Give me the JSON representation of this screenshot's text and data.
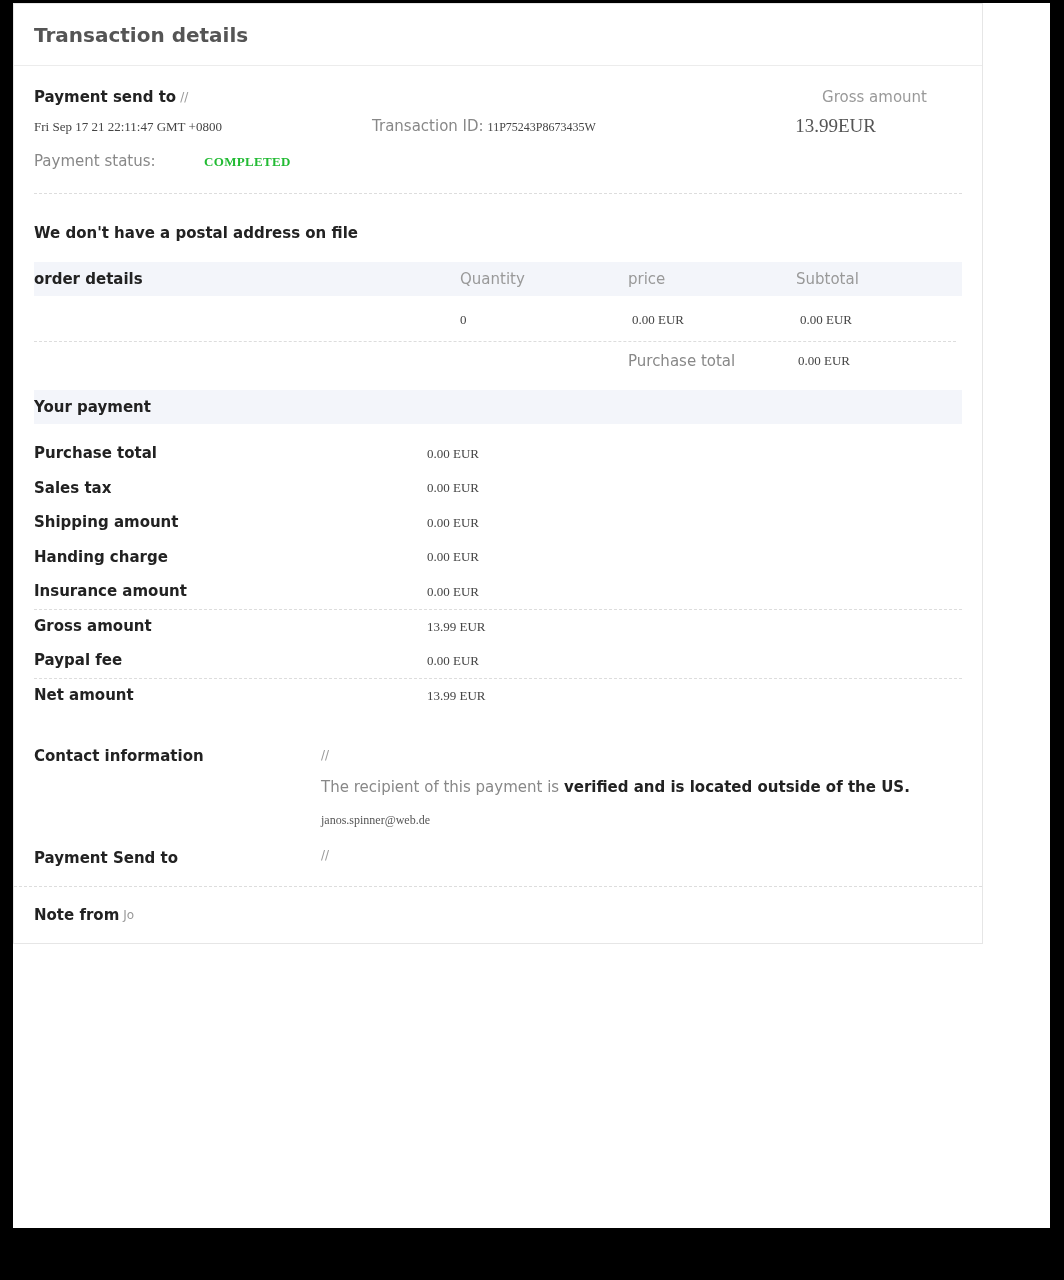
{
  "title": "Transaction details",
  "header": {
    "recipient_label": "Payment send to",
    "recipient_value": "//",
    "date": "Fri Sep 17 21 22:11:47 GMT +0800",
    "transaction_id_label": "Transaction ID:",
    "transaction_id": "11P75243P8673435W",
    "gross_label": "Gross amount",
    "gross_value": "13.99EUR",
    "status_label": "Payment status:",
    "status": "COMPLETED"
  },
  "address_note": "We don't have a postal address on file",
  "order": {
    "columns": [
      "order details",
      "Quantity",
      "price",
      "Subtotal"
    ],
    "rows": [
      {
        "cells": [
          "",
          "0",
          "0.00 EUR",
          "0.00 EUR"
        ]
      }
    ],
    "total_label": "Purchase total",
    "total_value": "0.00 EUR"
  },
  "payment": {
    "title": "Your payment",
    "rows": [
      {
        "label": "Purchase total",
        "value": "0.00 EUR",
        "separated": false
      },
      {
        "label": "Sales tax",
        "value": "0.00 EUR",
        "separated": false
      },
      {
        "label": "Shipping amount",
        "value": "0.00 EUR",
        "separated": false
      },
      {
        "label": "Handing charge",
        "value": "0.00 EUR",
        "separated": false
      },
      {
        "label": "Insurance amount",
        "value": "0.00 EUR",
        "separated": false
      },
      {
        "label": "Gross amount",
        "value": "13.99 EUR",
        "separated": true
      },
      {
        "label": "Paypal fee",
        "value": "0.00 EUR",
        "separated": false
      },
      {
        "label": "Net amount",
        "value": "13.99 EUR",
        "separated": true
      }
    ]
  },
  "contact": {
    "label": "Contact information",
    "value": "//",
    "verification": "The recipient of this payment is **verified and is located outside of the US.**",
    "email": "janos.spinner@web.de"
  },
  "send_to": {
    "label": "Payment Send to",
    "value": "//"
  },
  "note": {
    "label": "Note from",
    "value": "Jo"
  }
}
